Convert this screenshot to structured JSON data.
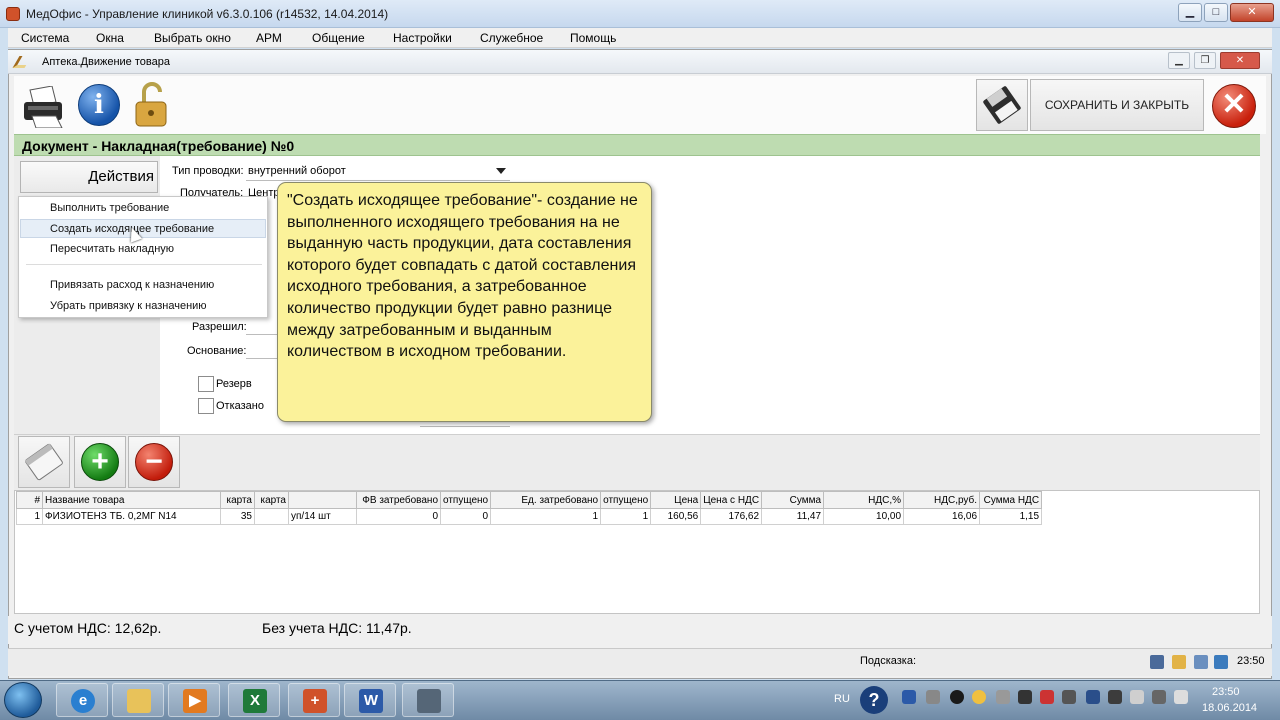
{
  "window": {
    "title": "МедОфис - Управление клиникой v6.3.0.106 (r14532, 14.04.2014)",
    "min": "▁",
    "max": "□",
    "close": "✕"
  },
  "menu": [
    "Система",
    "Окна",
    "Выбрать окно",
    "АРМ",
    "Общение",
    "Настройки",
    "Служебное",
    "Помощь"
  ],
  "inner": {
    "title": "Аптека.Движение товара",
    "min": "▁",
    "max": "❐",
    "close": "✕"
  },
  "toolbar": {
    "info_glyph": "i",
    "save_close": "СОХРАНИТЬ И ЗАКРЫТЬ",
    "close_glyph": "✕"
  },
  "document": {
    "title": "Документ - Накладная(требование) №0"
  },
  "actions": {
    "label": "Действия"
  },
  "form": {
    "type_label": "Тип проводки:",
    "type_value": "внутренний оборот",
    "recipient_label": "Получатель:",
    "recipient_value": "Центр",
    "allowed_label": "Разрешил:",
    "basis_label": "Основание:",
    "reserve_label": "Резерв",
    "refused_label": "Отказано"
  },
  "dropdown": [
    "Выполнить требование",
    "Создать исходящее требование",
    "Пересчитать накладную",
    "Привязать расход к назначению",
    "Убрать привязку к назначению"
  ],
  "tooltip": {
    "text": "\"Создать исходящее требование\"- создание не выполненного исходящего требования на не выданную часть продукции, дата составления которого будет совпадать с датой составления исходного требования, а затребованное количество продукции будет равно разнице между затребованным и выданным количеством в исходном требовании."
  },
  "grid": {
    "headers": [
      "#",
      "Название товара",
      "карта",
      "карта",
      "",
      "ФВ затребовано",
      "отпущено",
      "Ед. затребовано",
      "отпущено",
      "Цена",
      "Цена с НДС",
      "Сумма",
      "НДС,%",
      "НДС,руб.",
      "Сумма НДС"
    ],
    "rows": [
      [
        "1",
        "ФИЗИОТЕНЗ ТБ. 0,2МГ N14",
        "35",
        "",
        "уп/14 шт",
        "0",
        "0",
        "1",
        "1",
        "160,56",
        "176,62",
        "11,47",
        "10,00",
        "16,06",
        "1,15"
      ]
    ]
  },
  "totals": {
    "with_vat": "С учетом НДС: 12,62р.",
    "without_vat": "Без учета НДС: 11,47р."
  },
  "status": {
    "hint_label": "Подсказка:",
    "time": "23:50"
  },
  "taskbar": {
    "lang": "RU",
    "help": "?",
    "time": "23:50",
    "date": "18.06.2014"
  },
  "colors": {
    "doc_header": "#bedcb1",
    "tooltip_bg": "#fbf29a",
    "add": "#1e8c1c",
    "remove": "#d0230f"
  }
}
